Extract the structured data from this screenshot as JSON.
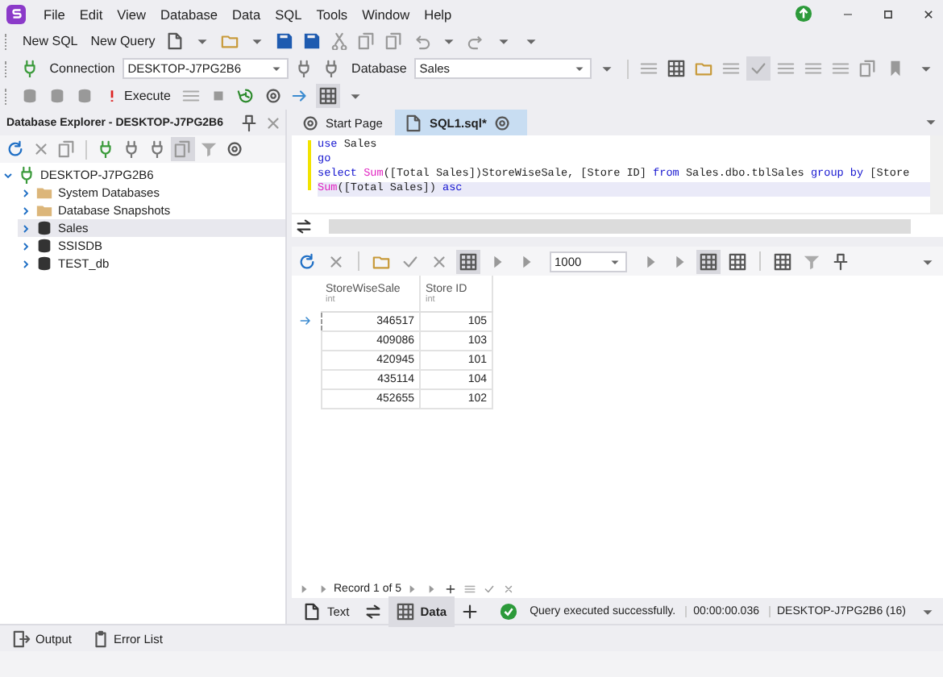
{
  "menu_bar": {
    "items": [
      "File",
      "Edit",
      "View",
      "Database",
      "Data",
      "SQL",
      "Tools",
      "Window",
      "Help"
    ]
  },
  "standard_toolbar": {
    "buttons": [
      "New SQL",
      "New Query"
    ]
  },
  "connection_toolbar": {
    "connection_label": "Connection",
    "connection": "DESKTOP-J7PG2B6",
    "database_label": "Database",
    "database": "Sales"
  },
  "execute_toolbar": {
    "execute": "Execute"
  },
  "explorer": {
    "title": "Database Explorer - DESKTOP-J7PG2B6",
    "tree": [
      {
        "label": "DESKTOP-J7PG2B6",
        "kind": "server",
        "expanded": true,
        "selected": false,
        "children": [
          {
            "label": "System Databases",
            "kind": "folder",
            "expanded": false,
            "selected": false
          },
          {
            "label": "Database Snapshots",
            "kind": "folder",
            "expanded": false,
            "selected": false
          },
          {
            "label": "Sales",
            "kind": "database",
            "expanded": false,
            "selected": true
          },
          {
            "label": "SSISDB",
            "kind": "database",
            "expanded": false,
            "selected": false
          },
          {
            "label": "TEST_db",
            "kind": "database",
            "expanded": false,
            "selected": false
          }
        ]
      }
    ]
  },
  "document_tabs": [
    {
      "label": "Start Page",
      "kind": "start",
      "selected": false
    },
    {
      "label": "SQL1.sql*",
      "kind": "sql",
      "selected": true
    }
  ],
  "editor": {
    "lines": [
      {
        "current": false,
        "tokens": [
          {
            "text": "use",
            "kind": "keyword"
          },
          {
            "text": " Sales",
            "kind": "plain"
          }
        ]
      },
      {
        "current": false,
        "tokens": [
          {
            "text": "go",
            "kind": "keyword"
          }
        ]
      },
      {
        "current": false,
        "tokens": [
          {
            "text": "select",
            "kind": "keyword"
          },
          {
            "text": " Sum",
            "kind": "function"
          },
          {
            "text": "([Total Sales])StoreWiseSale, [Store ID] ",
            "kind": "plain"
          },
          {
            "text": "from",
            "kind": "keyword"
          },
          {
            "text": " Sales.dbo.tblSales ",
            "kind": "plain"
          },
          {
            "text": "group by",
            "kind": "keyword"
          },
          {
            "text": " [Store",
            "kind": "plain"
          }
        ]
      },
      {
        "current": true,
        "tokens": [
          {
            "text": "Sum",
            "kind": "function"
          },
          {
            "text": "([Total Sales]) ",
            "kind": "plain"
          },
          {
            "text": "asc",
            "kind": "keyword"
          }
        ]
      }
    ]
  },
  "results": {
    "page_size": "1000",
    "columns": [
      {
        "name": "StoreWiseSale",
        "type": "int"
      },
      {
        "name": "Store ID",
        "type": "int"
      }
    ],
    "rows": [
      {
        "cells": [
          "346517",
          "105"
        ],
        "selected": true
      },
      {
        "cells": [
          "409086",
          "103"
        ],
        "selected": false
      },
      {
        "cells": [
          "420945",
          "101"
        ],
        "selected": false
      },
      {
        "cells": [
          "435114",
          "104"
        ],
        "selected": false
      },
      {
        "cells": [
          "452655",
          "102"
        ],
        "selected": false
      }
    ],
    "record_navigator": "Record 1 of 5",
    "view_tabs": [
      {
        "label": "Text",
        "kind": "text",
        "selected": false
      },
      {
        "label": "Data",
        "kind": "data",
        "selected": true
      }
    ],
    "status": "Query executed successfully.",
    "elapsed": "00:00:00.036",
    "server": "DESKTOP-J7PG2B6 (16)"
  },
  "bottom_panels": [
    {
      "label": "Output",
      "kind": "output"
    },
    {
      "label": "Error List",
      "kind": "errors"
    }
  ]
}
